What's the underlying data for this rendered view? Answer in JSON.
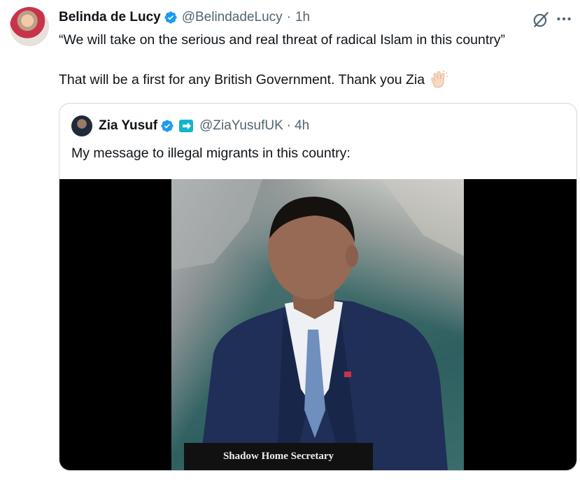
{
  "tweet": {
    "author_name": "Belinda de Lucy",
    "handle": "@BelindadeLucy",
    "separator": "·",
    "timestamp": "1h",
    "text_line1": "“We will take on the serious and real threat of radical Islam in this country”",
    "text_line2": "That will be a first for any British Government. Thank you Zia",
    "verified_color": "#1d9bf0"
  },
  "quoted": {
    "author_name": "Zia Yusuf",
    "handle": "@ZiaYusufUK",
    "separator": "·",
    "timestamp": "4h",
    "text": "My message to illegal migrants in this country:",
    "video": {
      "chyron": "Shadow Home Secretary"
    }
  },
  "icons": {
    "verified": "verified-badge-icon",
    "grok": "grok-icon",
    "more": "more-icon",
    "clap": "clapping-hands-emoji",
    "affiliation": "affiliation-badge-icon"
  }
}
